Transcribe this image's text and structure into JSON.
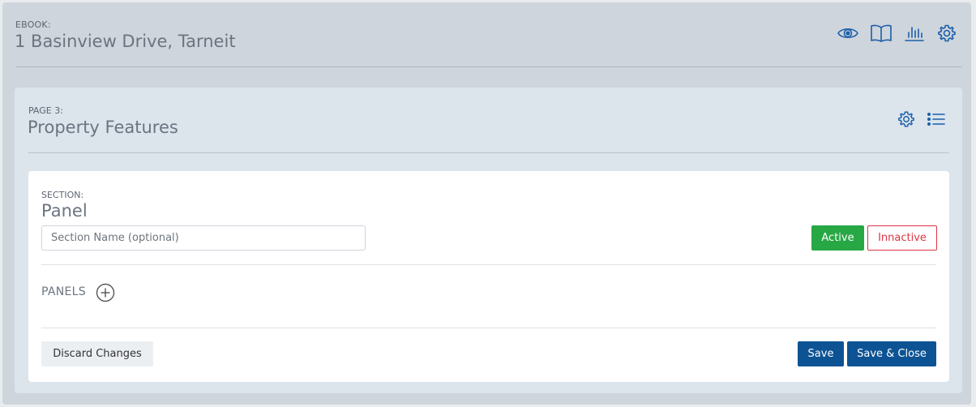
{
  "ebook": {
    "kicker": "EBOOK:",
    "title": "1 Basinview Drive, Tarneit",
    "icons": [
      "eye-icon",
      "book-icon",
      "chart-icon",
      "gear-icon"
    ]
  },
  "page": {
    "kicker": "PAGE 3:",
    "title": "Property Features",
    "icons": [
      "gear-icon",
      "list-icon"
    ]
  },
  "section": {
    "kicker": "SECTION:",
    "title": "Panel",
    "name_input": {
      "value": "",
      "placeholder": "Section Name (optional)"
    },
    "active_label": "Active",
    "inactive_label": "Innactive",
    "panels_label": "PANELS",
    "discard_label": "Discard Changes",
    "save_label": "Save",
    "save_close_label": "Save & Close"
  },
  "colors": {
    "accent": "#1a5ea9",
    "primary_button": "#0d5394",
    "active": "#28a745",
    "inactive": "#dc3545"
  }
}
